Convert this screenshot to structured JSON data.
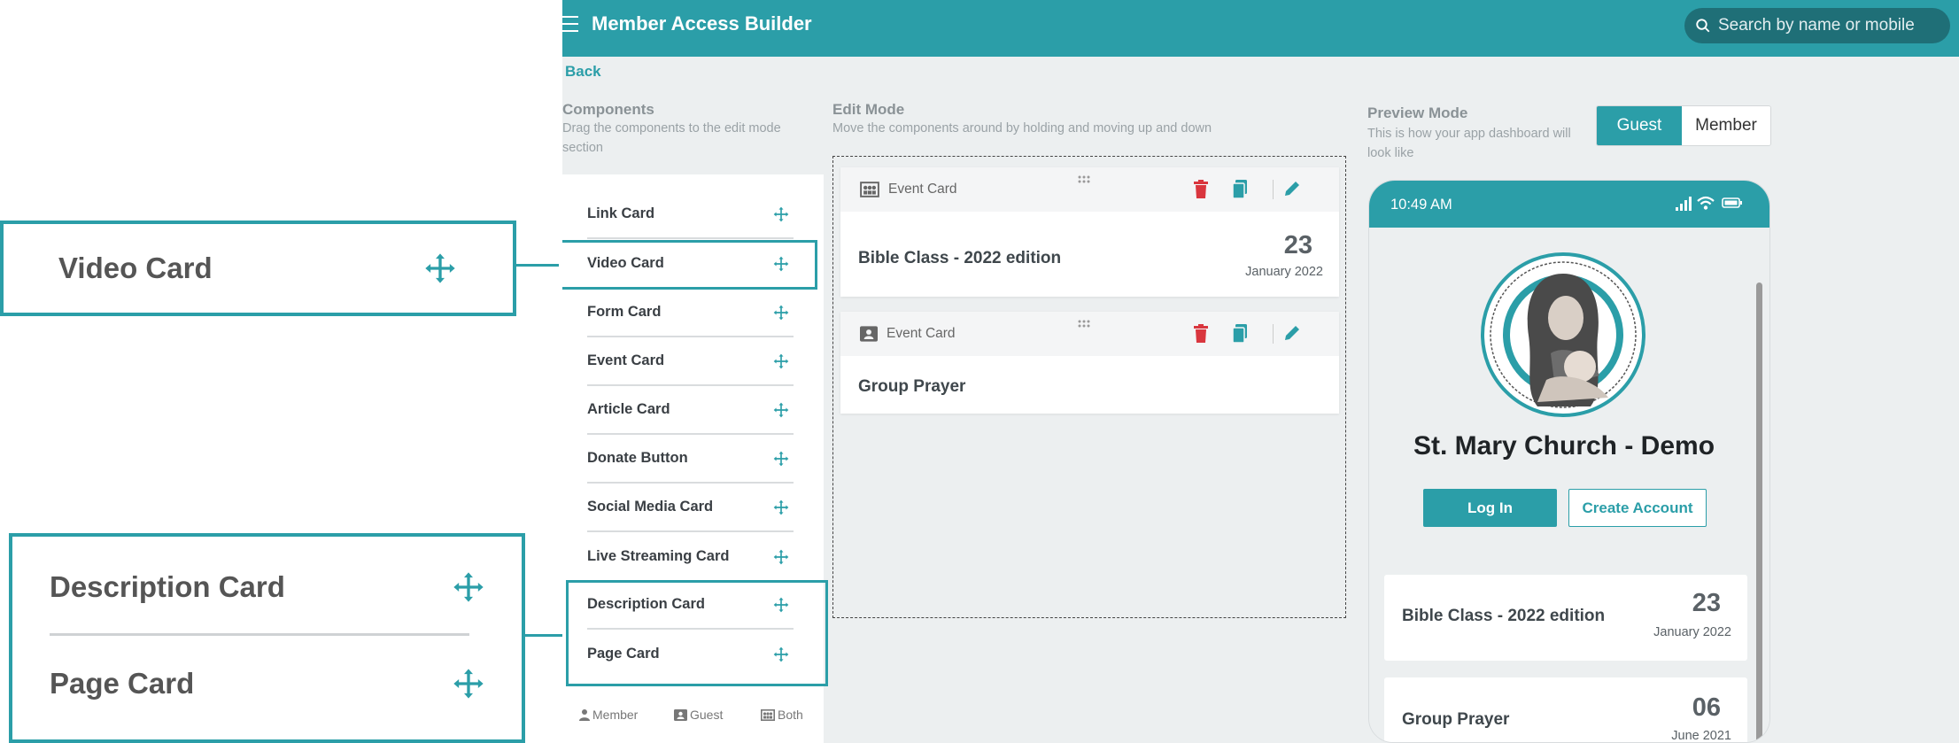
{
  "callouts": {
    "video": {
      "label": "Video Card"
    },
    "description": {
      "label": "Description Card"
    },
    "page": {
      "label": "Page Card"
    }
  },
  "header": {
    "title": "Member Access Builder",
    "search_placeholder": "Search by name or mobile"
  },
  "nav": {
    "back": "Back"
  },
  "components": {
    "title": "Components",
    "subtitle": "Drag the components to the edit mode section",
    "items": [
      {
        "label": "Link Card"
      },
      {
        "label": "Video Card"
      },
      {
        "label": "Form Card"
      },
      {
        "label": "Event Card"
      },
      {
        "label": "Article Card"
      },
      {
        "label": "Donate Button"
      },
      {
        "label": "Social Media Card"
      },
      {
        "label": "Live Streaming Card"
      },
      {
        "label": "Description Card"
      },
      {
        "label": "Page Card"
      }
    ],
    "footer": {
      "member": "Member",
      "guest": "Guest",
      "both": "Both"
    }
  },
  "edit": {
    "title": "Edit Mode",
    "subtitle": "Move the components around by holding and moving up and down",
    "cards": [
      {
        "type": "Event Card",
        "title": "Bible Class - 2022 edition",
        "day": "23",
        "month_year": "January 2022"
      },
      {
        "type": "Event Card",
        "title": "Group Prayer"
      }
    ]
  },
  "preview": {
    "title": "Preview Mode",
    "subtitle": "This is how your app dashboard will look like",
    "toggle": {
      "guest": "Guest",
      "member": "Member",
      "selected": "Guest"
    },
    "phone": {
      "time": "10:49 AM",
      "church_name": "St. Mary Church - Demo",
      "login": "Log In",
      "create_account": "Create Account",
      "cards": [
        {
          "title": "Bible Class - 2022 edition",
          "day": "23",
          "month_year": "January 2022"
        },
        {
          "title": "Group Prayer",
          "day": "06",
          "month_year": "June 2021"
        }
      ]
    }
  },
  "colors": {
    "accent": "#2b9ea8",
    "delete": "#d9363e",
    "background": "#eceff0"
  }
}
